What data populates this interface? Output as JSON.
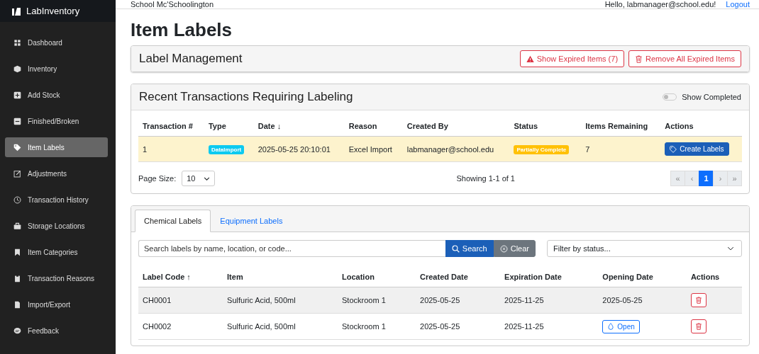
{
  "brand": {
    "name": "LabInventory"
  },
  "sidebar": {
    "items": [
      {
        "label": "Dashboard",
        "selected": false
      },
      {
        "label": "Inventory",
        "selected": false
      },
      {
        "label": "Add Stock",
        "selected": false
      },
      {
        "label": "Finished/Broken",
        "selected": false
      },
      {
        "label": "Item Labels",
        "selected": true
      },
      {
        "label": "Adjustments",
        "selected": false
      },
      {
        "label": "Transaction History",
        "selected": false
      },
      {
        "label": "Storage Locations",
        "selected": false
      },
      {
        "label": "Item Categories",
        "selected": false
      },
      {
        "label": "Transaction Reasons",
        "selected": false
      },
      {
        "label": "Import/Export",
        "selected": false
      },
      {
        "label": "Feedback",
        "selected": false
      }
    ]
  },
  "topbar": {
    "school": "School Mc'Schoolington",
    "greeting": "Hello, labmanager@school.edu!",
    "logout": "Logout"
  },
  "page_title": "Item Labels",
  "label_management": {
    "title": "Label Management",
    "buttons": [
      {
        "label": "Show Expired Items (7)",
        "kind": "warning"
      },
      {
        "label": "Remove All Expired Items",
        "kind": "trash"
      }
    ]
  },
  "transactions": {
    "title": "Recent Transactions Requiring Labeling",
    "toggle": {
      "label": "Show Completed",
      "on": false
    },
    "columns": [
      {
        "label": "Transaction #"
      },
      {
        "label": "Type"
      },
      {
        "label": "Date",
        "sort_mark": "↓"
      },
      {
        "label": "Reason"
      },
      {
        "label": "Created By"
      },
      {
        "label": "Status"
      },
      {
        "label": "Items Remaining"
      },
      {
        "label": "Actions"
      }
    ],
    "rows": [
      {
        "highlighted": true,
        "number": "1",
        "type": {
          "text": "DataImport",
          "color": "#0dcaf0"
        },
        "date": "2025-05-25 20:10:01",
        "reason": "Excel Import",
        "created_by": "labmanager@school.edu",
        "status": {
          "text": "Partially Complete",
          "color": "#ffc107"
        },
        "items_remaining": "7",
        "action": "Create Labels"
      }
    ],
    "page_size_label": "Page Size:",
    "page_size": "10",
    "showing": "Showing 1-1 of 1",
    "pagination": [
      {
        "label": "«",
        "selected": false,
        "disabled": true
      },
      {
        "label": "‹",
        "selected": false,
        "disabled": true
      },
      {
        "label": "1",
        "selected": true,
        "disabled": false
      },
      {
        "label": "›",
        "selected": false,
        "disabled": true
      },
      {
        "label": "»",
        "selected": false,
        "disabled": true
      }
    ]
  },
  "labels": {
    "tabs": [
      {
        "label": "Chemical Labels",
        "selected": true
      },
      {
        "label": "Equipment Labels",
        "selected": false
      }
    ],
    "search": {
      "placeholder": "Search labels by name, location, or code...",
      "button": "Search",
      "clear": "Clear"
    },
    "filter": {
      "placeholder": "Filter by status..."
    },
    "columns": [
      {
        "label": "Label Code",
        "sort_mark": "↑"
      },
      {
        "label": "Item"
      },
      {
        "label": "Location"
      },
      {
        "label": "Created Date"
      },
      {
        "label": "Expiration Date"
      },
      {
        "label": "Opening Date"
      },
      {
        "label": "Actions"
      }
    ],
    "rows": [
      {
        "highlighted": true,
        "code": "CH0001",
        "item": "Sulfuric Acid, 500ml",
        "location": "Stockroom 1",
        "created": "2025-05-25",
        "expiration": "2025-11-25",
        "opening": {
          "kind": "date",
          "text": "2025-05-25"
        }
      },
      {
        "highlighted": false,
        "code": "CH0002",
        "item": "Sulfuric Acid, 500ml",
        "location": "Stockroom 1",
        "created": "2025-05-25",
        "expiration": "2025-11-25",
        "opening": {
          "kind": "button",
          "text": "Open"
        }
      }
    ]
  }
}
